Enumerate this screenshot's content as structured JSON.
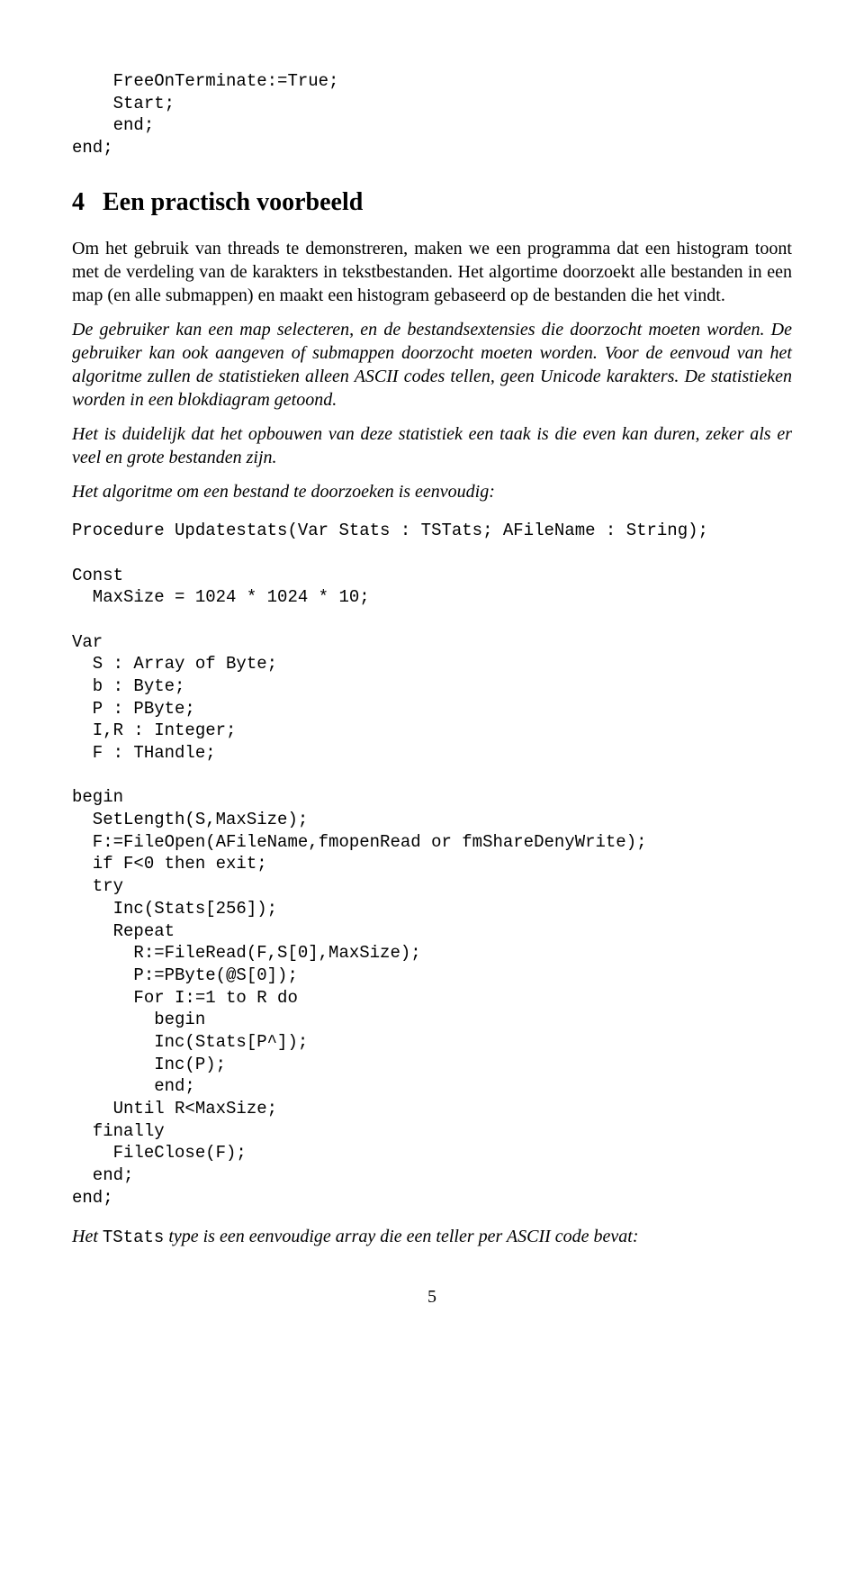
{
  "code1": "    FreeOnTerminate:=True;\n    Start;\n    end;\nend;",
  "section": {
    "number": "4",
    "title": "Een practisch voorbeeld"
  },
  "para1": "Om het gebruik van threads te demonstreren, maken we een programma dat een histogram toont met de verdeling van de karakters in tekstbestanden. Het algortime doorzoekt alle bestanden in een map (en alle submappen) en maakt een histogram gebaseerd op de bestanden die het vindt.",
  "para2": "De gebruiker kan een map selecteren, en de bestandsextensies die doorzocht moeten worden. De gebruiker kan ook aangeven of submappen doorzocht moeten worden. Voor de eenvoud van het algoritme zullen de statistieken alleen ASCII codes tellen, geen Unicode karakters. De statistieken worden in een blokdiagram getoond.",
  "para3": "Het is duidelijk dat het opbouwen van deze statistiek een taak is die even kan duren, zeker als er veel en grote bestanden zijn.",
  "para4": "Het algoritme om een bestand te doorzoeken is eenvoudig:",
  "code2": "Procedure Updatestats(Var Stats : TSTats; AFileName : String);\n\nConst\n  MaxSize = 1024 * 1024 * 10;\n\nVar\n  S : Array of Byte;\n  b : Byte;\n  P : PByte;\n  I,R : Integer;\n  F : THandle;\n\nbegin\n  SetLength(S,MaxSize);\n  F:=FileOpen(AFileName,fmopenRead or fmShareDenyWrite);\n  if F<0 then exit;\n  try\n    Inc(Stats[256]);\n    Repeat\n      R:=FileRead(F,S[0],MaxSize);\n      P:=PByte(@S[0]);\n      For I:=1 to R do\n        begin\n        Inc(Stats[P^]);\n        Inc(P);\n        end;\n    Until R<MaxSize;\n  finally\n    FileClose(F);\n  end;\nend;",
  "para5_pre": "Het ",
  "para5_code": "TStats",
  "para5_post": " type is een eenvoudige array die een teller per ASCII code bevat:",
  "pageNumber": "5"
}
